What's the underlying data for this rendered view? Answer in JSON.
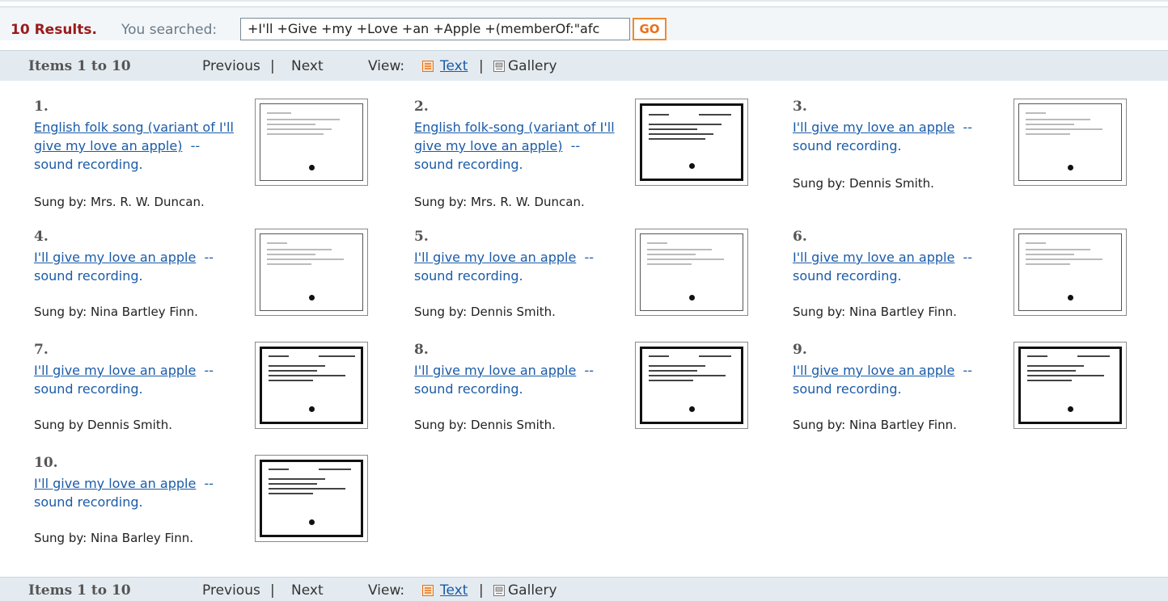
{
  "search": {
    "count": "10 Results.",
    "label": "You searched:",
    "query": "+I'll +Give +my +Love +an +Apple  +(memberOf:\"afc",
    "go": "GO"
  },
  "nav": {
    "items_range": "Items 1 to 10",
    "previous": "Previous",
    "separator": "|",
    "next": "Next",
    "view_label": "View:",
    "text": "Text",
    "gallery": "Gallery"
  },
  "results": [
    {
      "num": "1.",
      "title": "English folk song (variant of I'll give my love an apple)",
      "suffix": "--",
      "type": "sound recording.",
      "sung": "Sung by: Mrs. R. W. Duncan.",
      "icon": "catalog-card-thumbnail"
    },
    {
      "num": "2.",
      "title": "English folk-song (variant of I'll give my love an apple)",
      "suffix": "--",
      "type": "sound recording.",
      "sung": "Sung by: Mrs. R. W. Duncan.",
      "icon": "catalog-card-thumbnail"
    },
    {
      "num": "3.",
      "title": "I'll give my love an apple",
      "suffix": "--",
      "type": "sound recording.",
      "sung": "Sung by: Dennis Smith.",
      "icon": "catalog-card-thumbnail"
    },
    {
      "num": "4.",
      "title": "I'll give my love an apple",
      "suffix": "--",
      "type": "sound recording.",
      "sung": "Sung by: Nina Bartley Finn.",
      "icon": "catalog-card-thumbnail"
    },
    {
      "num": "5.",
      "title": "I'll give my love an apple",
      "suffix": "--",
      "type": "sound recording.",
      "sung": "Sung by: Dennis Smith.",
      "icon": "catalog-card-thumbnail"
    },
    {
      "num": "6.",
      "title": "I'll give my love an apple",
      "suffix": "--",
      "type": "sound recording.",
      "sung": "Sung by: Nina Bartley Finn.",
      "icon": "catalog-card-thumbnail"
    },
    {
      "num": "7.",
      "title": "I'll give my love an apple",
      "suffix": "--",
      "type": "sound recording.",
      "sung": "Sung by Dennis Smith.",
      "icon": "catalog-card-thumbnail"
    },
    {
      "num": "8.",
      "title": "I'll give my love an apple",
      "suffix": "--",
      "type": "sound recording.",
      "sung": "Sung by: Dennis Smith.",
      "icon": "catalog-card-thumbnail"
    },
    {
      "num": "9.",
      "title": "I'll give my love an apple",
      "suffix": "--",
      "type": "sound recording.",
      "sung": "Sung by: Nina Bartley Finn.",
      "icon": "catalog-card-thumbnail"
    },
    {
      "num": "10.",
      "title": "I'll give my love an apple",
      "suffix": "--",
      "type": "sound recording.",
      "sung": "Sung by: Nina Barley Finn.",
      "icon": "catalog-card-thumbnail"
    }
  ],
  "colors": {
    "count": "#9b1b1b",
    "link": "#1a5ba8",
    "go_border": "#f08a2a",
    "nav_bg": "#e4ebf0"
  }
}
